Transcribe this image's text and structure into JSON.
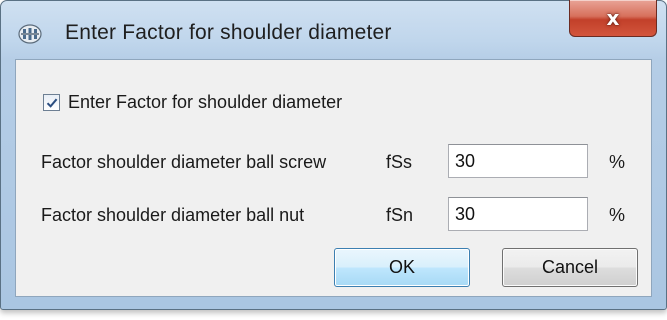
{
  "window": {
    "title": "Enter Factor for shoulder diameter",
    "close_label": "x"
  },
  "checkbox": {
    "label": "Enter Factor for shoulder diameter",
    "checked": true
  },
  "fields": [
    {
      "label": "Factor shoulder diameter ball screw",
      "symbol": "fSs",
      "value": "30",
      "unit": "%"
    },
    {
      "label": "Factor shoulder diameter ball nut",
      "symbol": "fSn",
      "value": "30",
      "unit": "%"
    }
  ],
  "buttons": {
    "ok_label": "OK",
    "cancel_label": "Cancel"
  },
  "colors": {
    "accent": "#3c7fb1",
    "close": "#c2402a"
  },
  "icons": {
    "app": "app-icon",
    "close": "close-icon",
    "check": "checkmark-icon"
  }
}
